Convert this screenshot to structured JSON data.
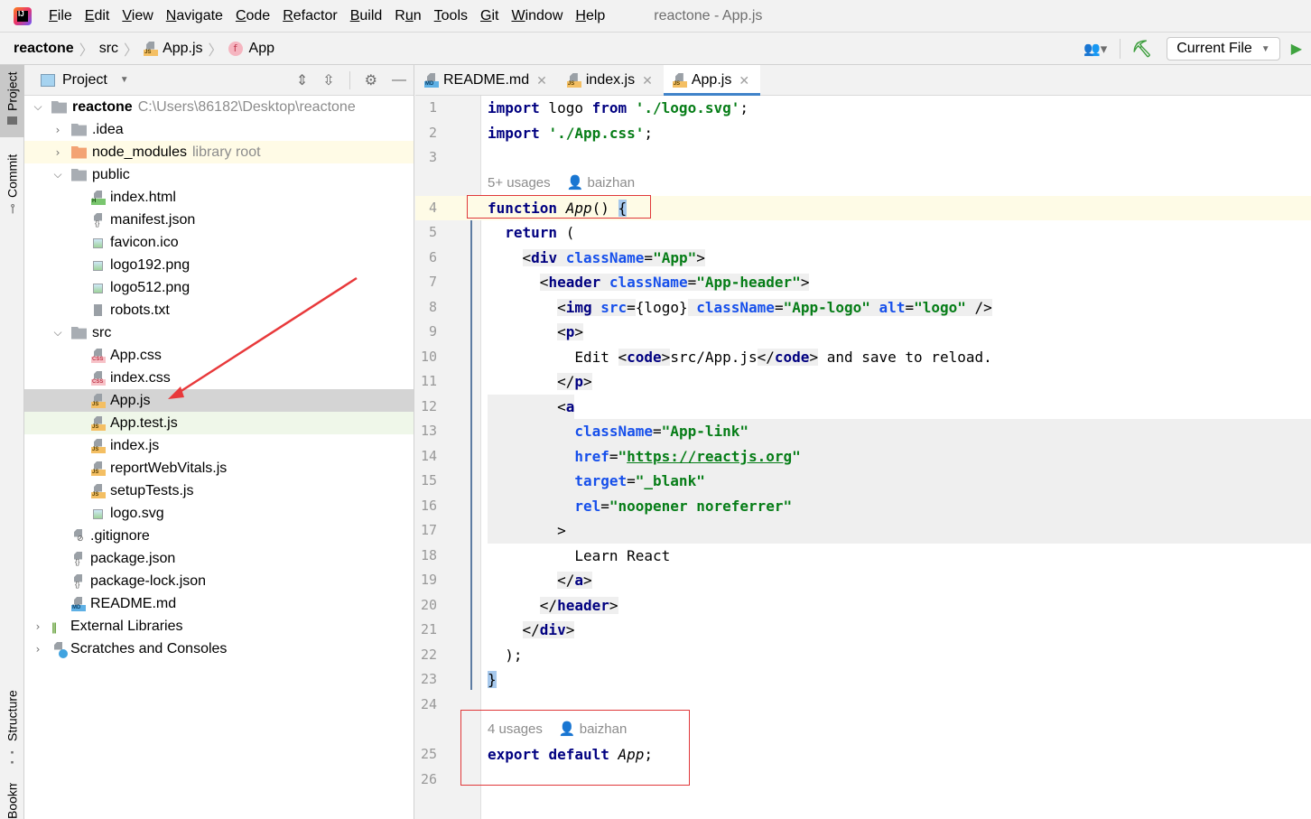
{
  "menubar": {
    "logo": "IJ",
    "items": [
      {
        "label": "File",
        "mn": "F",
        "rest": "ile"
      },
      {
        "label": "Edit",
        "mn": "E",
        "rest": "dit"
      },
      {
        "label": "View",
        "mn": "V",
        "rest": "iew"
      },
      {
        "label": "Navigate",
        "mn": "N",
        "rest": "avigate"
      },
      {
        "label": "Code",
        "mn": "C",
        "rest": "ode"
      },
      {
        "label": "Refactor",
        "mn": "R",
        "rest": "efactor"
      },
      {
        "label": "Build",
        "mn": "B",
        "rest": "uild"
      },
      {
        "label": "Run",
        "mn": "R",
        "rest": "un"
      },
      {
        "label": "Tools",
        "mn": "T",
        "rest": "ools"
      },
      {
        "label": "Git",
        "mn": "G",
        "rest": "it"
      },
      {
        "label": "Window",
        "mn": "W",
        "rest": "indow"
      },
      {
        "label": "Help",
        "mn": "H",
        "rest": "elp"
      }
    ],
    "window_title": "reactone - App.js"
  },
  "breadcrumb": {
    "project": "reactone",
    "folder": "src",
    "file": "App.js",
    "file_tag": "JS",
    "symbol_icon": "f",
    "symbol": "App"
  },
  "toolbar": {
    "run_config": "Current File",
    "user_icon": "👥▾",
    "build_icon": "⛏",
    "run_icon": "▶"
  },
  "left_strip": {
    "top_tabs": [
      "Project",
      "Commit"
    ],
    "bottom_tabs": [
      "Structure",
      "Bookmarks"
    ]
  },
  "project_panel": {
    "title": "Project",
    "tree": [
      {
        "depth": 0,
        "arrow": "open",
        "icon": "root-folder",
        "label": "reactone",
        "hint": "C:\\Users\\86182\\Desktop\\reactone",
        "bold": true
      },
      {
        "depth": 1,
        "arrow": "closed",
        "icon": "folder",
        "label": ".idea"
      },
      {
        "depth": 1,
        "arrow": "closed",
        "icon": "folder-orange",
        "label": "node_modules",
        "hint": "library root",
        "highlight": "yellow"
      },
      {
        "depth": 1,
        "arrow": "open",
        "icon": "folder",
        "label": "public"
      },
      {
        "depth": 2,
        "icon": "html",
        "tag": "H",
        "label": "index.html"
      },
      {
        "depth": 2,
        "icon": "json",
        "label": "manifest.json"
      },
      {
        "depth": 2,
        "icon": "image",
        "label": "favicon.ico"
      },
      {
        "depth": 2,
        "icon": "image",
        "label": "logo192.png"
      },
      {
        "depth": 2,
        "icon": "image",
        "label": "logo512.png"
      },
      {
        "depth": 2,
        "icon": "text",
        "label": "robots.txt"
      },
      {
        "depth": 1,
        "arrow": "open",
        "icon": "folder",
        "label": "src"
      },
      {
        "depth": 2,
        "icon": "css",
        "tag": "CSS",
        "label": "App.css"
      },
      {
        "depth": 2,
        "icon": "css",
        "tag": "CSS",
        "label": "index.css"
      },
      {
        "depth": 2,
        "icon": "js",
        "tag": "JS",
        "label": "App.js",
        "highlight": "selected"
      },
      {
        "depth": 2,
        "icon": "js-test",
        "tag": "JS",
        "label": "App.test.js",
        "highlight": "green"
      },
      {
        "depth": 2,
        "icon": "js",
        "tag": "JS",
        "label": "index.js"
      },
      {
        "depth": 2,
        "icon": "js",
        "tag": "JS",
        "label": "reportWebVitals.js"
      },
      {
        "depth": 2,
        "icon": "js",
        "tag": "JS",
        "label": "setupTests.js"
      },
      {
        "depth": 2,
        "icon": "image",
        "label": "logo.svg"
      },
      {
        "depth": 1,
        "icon": "ignore",
        "label": ".gitignore"
      },
      {
        "depth": 1,
        "icon": "json",
        "label": "package.json"
      },
      {
        "depth": 1,
        "icon": "json",
        "label": "package-lock.json"
      },
      {
        "depth": 1,
        "icon": "md",
        "tag": "MD",
        "label": "README.md"
      },
      {
        "depth": 0,
        "arrow": "closed",
        "icon": "libraries",
        "label": "External Libraries"
      },
      {
        "depth": 0,
        "arrow": "closed",
        "icon": "scratches",
        "label": "Scratches and Consoles"
      }
    ]
  },
  "editor_tabs": [
    {
      "label": "README.md",
      "tag": "MD",
      "active": false
    },
    {
      "label": "index.js",
      "tag": "JS",
      "active": false
    },
    {
      "label": "App.js",
      "tag": "JS",
      "active": true
    }
  ],
  "editor": {
    "hints": [
      {
        "before_line": 4,
        "usages": "5+ usages",
        "author": "baizhan"
      },
      {
        "before_line": 25,
        "usages": "4 usages",
        "author": "baizhan"
      }
    ],
    "lines": [
      {
        "n": "1",
        "html": "<span class=\"kw\">import</span> logo <span class=\"kw\">from</span> <span class=\"str\">'./logo.svg'</span>;"
      },
      {
        "n": "2",
        "html": "<span class=\"kw\">import</span> <span class=\"str\">'./App.css'</span>;"
      },
      {
        "n": "3",
        "html": ""
      },
      {
        "n": "4",
        "html": "<span class=\"kw\">function</span> <span class=\"it\">App</span>() <span class=\"braceh\">{</span>"
      },
      {
        "n": "5",
        "html": "  <span class=\"kw\">return</span> ("
      },
      {
        "n": "6",
        "html": "    <span class=\"bg-grey\">&lt;<span class=\"tagn\">div</span> <span class=\"attr\">className</span>=<span class=\"str\">\"App\"</span>&gt;</span>"
      },
      {
        "n": "7",
        "html": "      <span class=\"bg-grey\">&lt;<span class=\"tagn\">header</span> <span class=\"attr\">className</span>=<span class=\"str\">\"App-header\"</span>&gt;</span>"
      },
      {
        "n": "8",
        "html": "        <span class=\"bg-grey\">&lt;<span class=\"tagn\">img</span> <span class=\"attr\">src</span>=</span>{logo}<span class=\"bg-grey\"> <span class=\"attr\">className</span>=<span class=\"str\">\"App-logo\"</span> <span class=\"attr\">alt</span>=<span class=\"str\">\"logo\"</span> /&gt;</span>"
      },
      {
        "n": "9",
        "html": "        <span class=\"bg-grey\">&lt;<span class=\"tagn\">p</span>&gt;</span>"
      },
      {
        "n": "10",
        "html": "          Edit <span class=\"bg-grey\">&lt;<span class=\"tagn\">code</span>&gt;</span>src/App.js<span class=\"bg-grey\">&lt;/<span class=\"tagn\">code</span>&gt;</span> and save to reload."
      },
      {
        "n": "11",
        "html": "        <span class=\"bg-grey\">&lt;/<span class=\"tagn\">p</span>&gt;</span>"
      },
      {
        "n": "12",
        "html": "        &lt;<span class=\"tagn\">a</span>"
      },
      {
        "n": "13",
        "html": "          <span class=\"attr\">className</span>=<span class=\"str\">\"App-link\"</span>"
      },
      {
        "n": "14",
        "html": "          <span class=\"attr\">href</span>=<span class=\"str\">\"<u>https://reactjs.org</u>\"</span>"
      },
      {
        "n": "15",
        "html": "          <span class=\"attr\">target</span>=<span class=\"str\">\"_blank\"</span>"
      },
      {
        "n": "16",
        "html": "          <span class=\"attr\">rel</span>=<span class=\"str\">\"noopener noreferrer\"</span>"
      },
      {
        "n": "17",
        "html": "        &gt;"
      },
      {
        "n": "18",
        "html": "          Learn React"
      },
      {
        "n": "19",
        "html": "        <span class=\"bg-grey\">&lt;/<span class=\"tagn\">a</span>&gt;</span>"
      },
      {
        "n": "20",
        "html": "      <span class=\"bg-grey\">&lt;/<span class=\"tagn\">header</span>&gt;</span>"
      },
      {
        "n": "21",
        "html": "    <span class=\"bg-grey\">&lt;/<span class=\"tagn\">div</span>&gt;</span>"
      },
      {
        "n": "22",
        "html": "  );"
      },
      {
        "n": "23",
        "html": "<span class=\"braceh\">}</span>"
      },
      {
        "n": "24",
        "html": ""
      },
      {
        "n": "25",
        "html": "<span class=\"kw\">export</span> <span class=\"kw\">default</span> <span class=\"it\">App</span>;"
      },
      {
        "n": "26",
        "html": ""
      }
    ]
  },
  "annotations": {
    "arrow_color": "#e8393b",
    "box_color": "#e0383a"
  }
}
